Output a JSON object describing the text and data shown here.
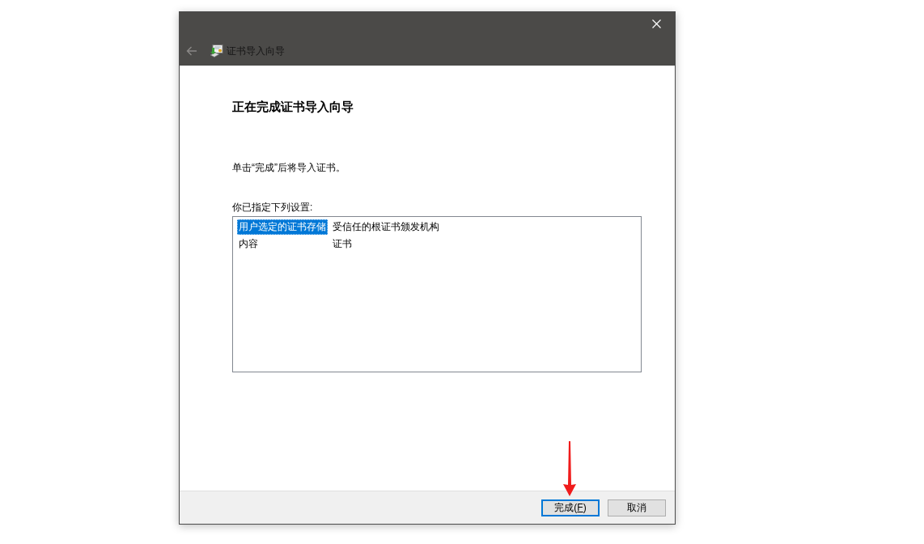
{
  "window": {
    "title": "证书导入向导",
    "back_disabled": true
  },
  "heading": "正在完成证书导入向导",
  "instruction": "单击“完成”后将导入证书。",
  "settings_label": "你已指定下列设置:",
  "settings": {
    "rows": [
      {
        "selected": true,
        "cells": [
          "用户选定的证书存储",
          "受信任的根证书颁发机构"
        ]
      },
      {
        "selected": false,
        "cells": [
          "内容",
          "证书"
        ]
      }
    ]
  },
  "buttons": [
    {
      "label": "完成(",
      "access_key": "F",
      "label_end": ")",
      "focused": true
    },
    {
      "label": "取消",
      "focused": false
    }
  ]
}
